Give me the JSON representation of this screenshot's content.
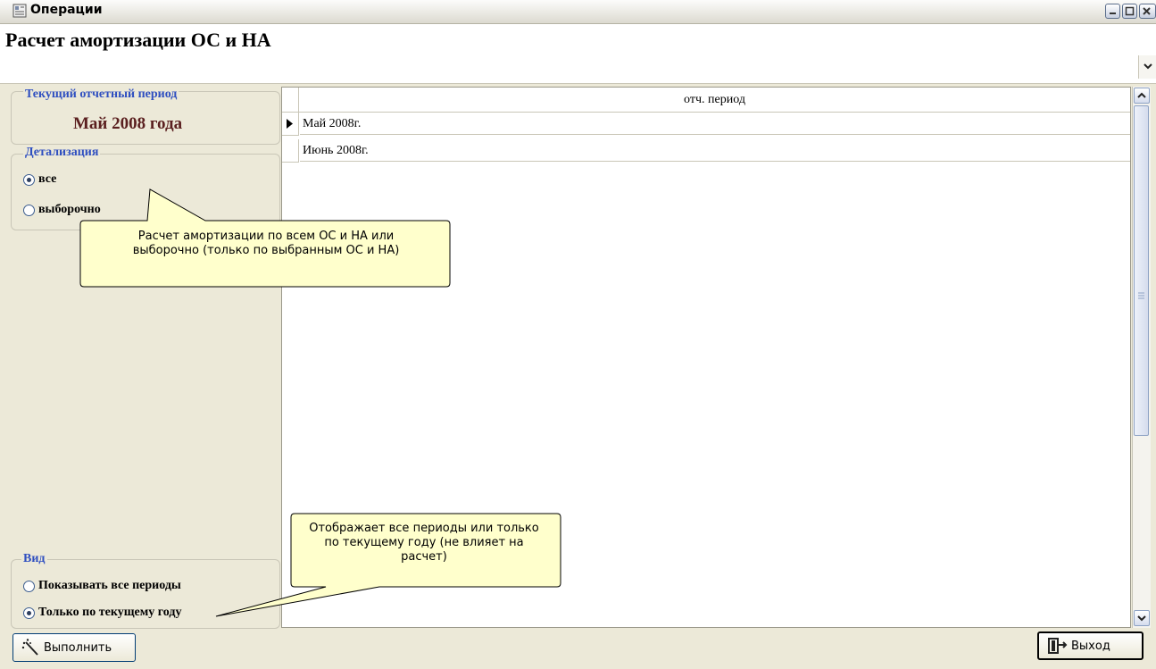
{
  "window": {
    "title": "Операции",
    "icon": "app-icon"
  },
  "header": {
    "title": "Расчет амортизации ОС и НА"
  },
  "left_panel": {
    "period_group": {
      "legend": "Текущий отчетный период",
      "value": "Май 2008 года"
    },
    "detail_group": {
      "legend": "Детализация",
      "options": [
        {
          "label": "все",
          "selected": true
        },
        {
          "label": "выборочно",
          "selected": false
        }
      ]
    },
    "view_group": {
      "legend": "Вид",
      "options": [
        {
          "label": "Показывать все периоды",
          "selected": false
        },
        {
          "label": "Только по текущему году",
          "selected": true
        }
      ]
    }
  },
  "grid": {
    "header": "отч. период",
    "rows": [
      {
        "label": "Май 2008г.",
        "current": true
      },
      {
        "label": "Июнь 2008г.",
        "current": false
      }
    ]
  },
  "callouts": {
    "detail_tip": "Расчет амортизации по всем ОС и НА или выборочно (только по выбранным ОС и НА)",
    "view_tip": "Отображает все периоды или только по текущему году (не влияет на расчет)"
  },
  "buttons": {
    "run_label": "Выполнить",
    "exit_label": "Выход"
  },
  "colors": {
    "legend": "#2f4fc0",
    "period_value": "#5a1f1f",
    "window_bg": "#ece9d8"
  }
}
